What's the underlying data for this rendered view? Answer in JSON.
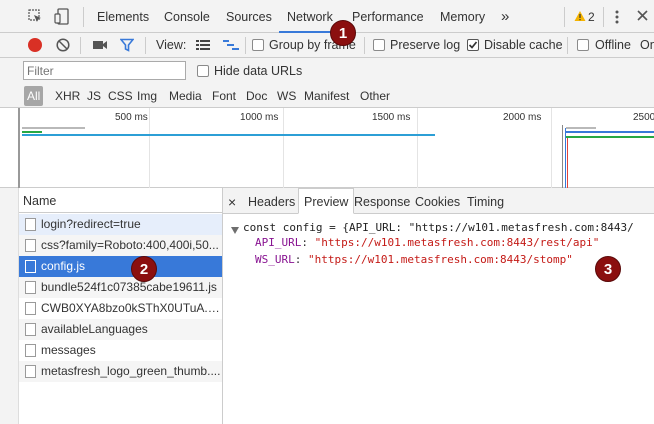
{
  "tabs": [
    "Elements",
    "Console",
    "Sources",
    "Network",
    "Performance",
    "Memory"
  ],
  "more_tabs_glyph": "»",
  "warnings": {
    "count": "2"
  },
  "toolbar": {
    "view_label": "View:",
    "group_by_frame": "Group by frame",
    "preserve_log": "Preserve log",
    "disable_cache": "Disable cache",
    "offline": "Offline",
    "online_trunc": "On"
  },
  "filter": {
    "placeholder": "Filter",
    "hide_data_urls": "Hide data URLs"
  },
  "types": [
    "All",
    "XHR",
    "JS",
    "CSS",
    "Img",
    "Media",
    "Font",
    "Doc",
    "WS",
    "Manifest",
    "Other"
  ],
  "timeline": {
    "ticks": [
      "500 ms",
      "1000 ms",
      "1500 ms",
      "2000 ms",
      "2500"
    ]
  },
  "requests": {
    "header": "Name",
    "items": [
      "login?redirect=true",
      "css?family=Roboto:400,400i,50...",
      "config.js",
      "bundle524f1c07385cabe19611.js",
      "CWB0XYA8bzo0kSThX0UTuA.w...",
      "availableLanguages",
      "messages",
      "metasfresh_logo_green_thumb...."
    ],
    "selected_index": 2
  },
  "detail": {
    "close": "×",
    "tabs": [
      "Headers",
      "Preview",
      "Response",
      "Cookies",
      "Timing"
    ],
    "active_tab": "Preview",
    "preview": {
      "line1": "const config = {API_URL: \"https://w101.metasfresh.com:8443/",
      "line2_key": "API_URL",
      "line2_val": "\"https://w101.metasfresh.com:8443/rest/api\"",
      "line3_key": "WS_URL",
      "line3_val": "\"https://w101.metasfresh.com:8443/stomp\""
    }
  },
  "annotations": [
    "1",
    "2",
    "3"
  ],
  "colors": {
    "accent": "#3879d9",
    "record": "#d93025",
    "badge": "#8b0f0f"
  }
}
